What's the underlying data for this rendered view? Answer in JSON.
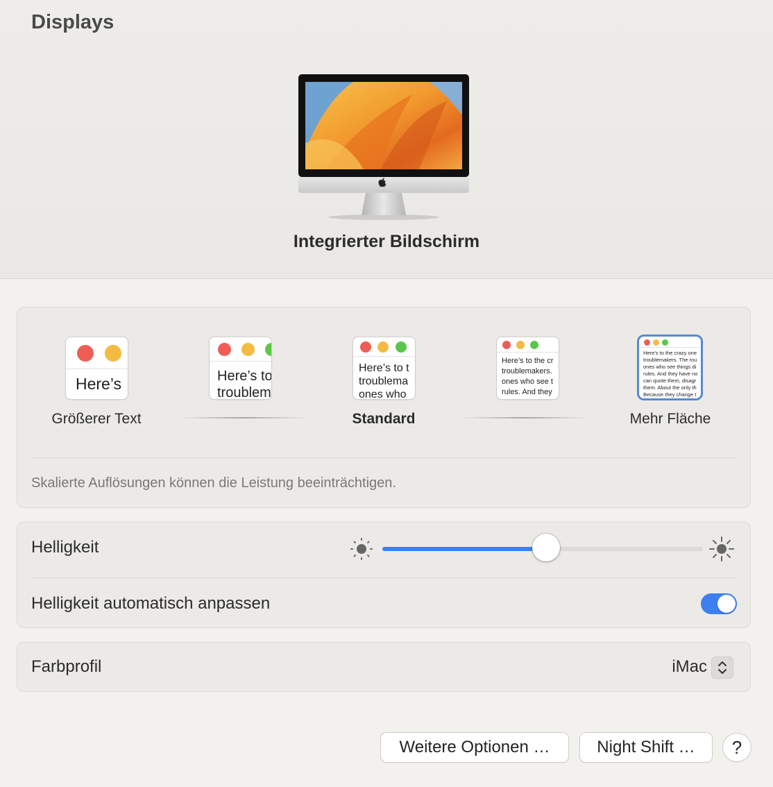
{
  "header": {
    "title": "Displays",
    "display_name": "Integrierter Bildschirm"
  },
  "scaling": {
    "options": [
      {
        "label": "Größerer Text",
        "preview_text": "Here’s"
      },
      {
        "label": "",
        "preview_text": "Here’s to troublem"
      },
      {
        "label": "Standard",
        "preview_text": "Here’s to t troublema ones who"
      },
      {
        "label": "",
        "preview_text": "Here’s to the cr troublemakers. ones who see t rules. And they"
      },
      {
        "label": "Mehr Fläche",
        "preview_text": "Here’s to the crazy one troublemakers. The rou ones who see things di rules. And they have no can quote them, disagr them. About the only th Because they change t"
      }
    ],
    "selected_index": 4,
    "note": "Skalierte Auflösungen können die Leistung beeinträchtigen."
  },
  "brightness": {
    "label": "Helligkeit",
    "level": 0.51,
    "auto_label": "Helligkeit automatisch anpassen",
    "auto_enabled": true
  },
  "color_profile": {
    "label": "Farbprofil",
    "value": "iMac"
  },
  "buttons": {
    "more_options": "Weitere Optionen …",
    "night_shift": "Night Shift …",
    "help": "?"
  },
  "colors": {
    "accent": "#3c7ff0",
    "selection": "#5689d6"
  }
}
